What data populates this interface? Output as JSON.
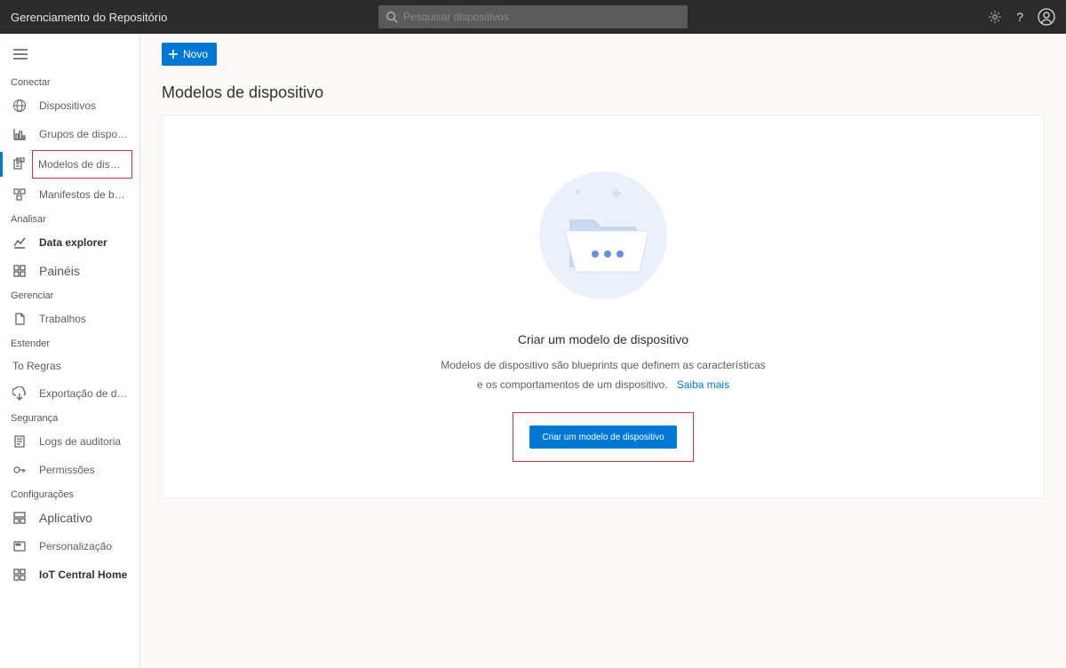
{
  "header": {
    "app_title": "Gerenciamento do Repositório",
    "search_placeholder": "Pesquisar dispositivos"
  },
  "toolbar": {
    "new_label": "Novo"
  },
  "page": {
    "title": "Modelos de dispositivo"
  },
  "empty": {
    "title": "Criar um modelo de dispositivo",
    "desc_line1": "Modelos de dispositivo são blueprints que definem as características",
    "desc_line2": "e os comportamentos de um dispositivo.",
    "learn_more": "Saiba mais",
    "cta": "Criar um modelo de dispositivo"
  },
  "sidebar": {
    "sections": {
      "connect": "Conectar",
      "analyze": "Analisar",
      "manage": "Gerenciar",
      "extend": "Estender",
      "security": "Segurança",
      "settings": "Configurações"
    },
    "items": {
      "devices": "Dispositivos",
      "device_groups": "Grupos de dispositivos",
      "device_templates": "Modelos de dispositivo",
      "edge_manifests": "Manifestos de borda",
      "data_explorer": "Data explorer",
      "dashboards": "Painéis",
      "jobs": "Trabalhos",
      "rules": "To Regras",
      "data_export": "Exportação de dados",
      "audit_logs": "Logs de auditoria",
      "permissions": "Permissões",
      "application": "Aplicativo",
      "customization": "Personalização",
      "iot_central_home": "IoT Central Home"
    }
  }
}
